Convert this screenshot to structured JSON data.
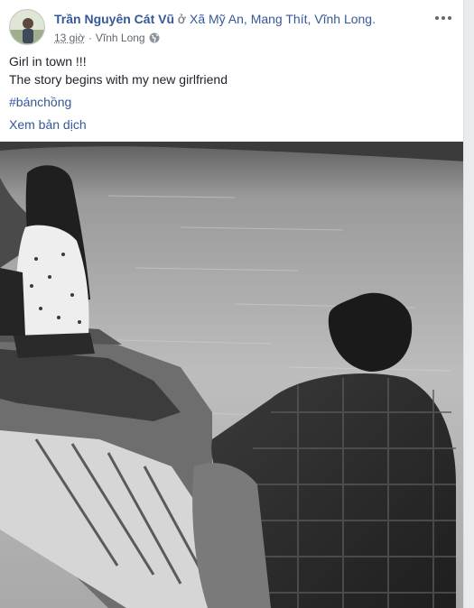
{
  "post": {
    "author": "Trần Nguyên Cát Vũ",
    "location_prefix": "ở",
    "location": "Xã Mỹ An, Mang Thít, Vĩnh Long.",
    "timestamp": "13 giờ",
    "separator": "·",
    "place": "Vĩnh Long",
    "privacy_icon": "globe-icon",
    "menu_icon": "more-options-icon",
    "text_lines": [
      "Girl in town !!!",
      "The story begins with my new girlfriend"
    ],
    "hashtag": "#bánchồng",
    "translate_link": "Xem bản dịch"
  },
  "colors": {
    "link": "#365899",
    "text": "#1d2129",
    "muted": "#616770",
    "background": "#e9ebee"
  }
}
